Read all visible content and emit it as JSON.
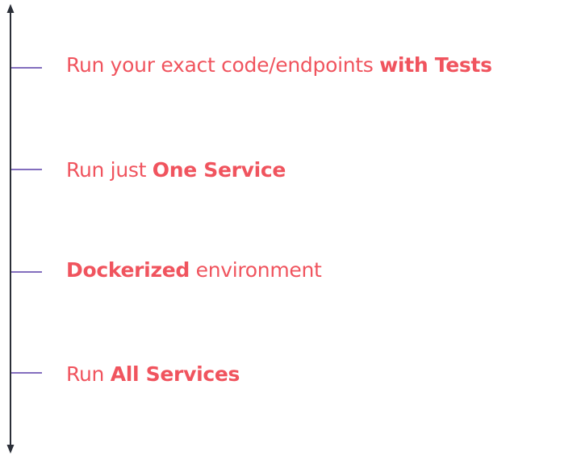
{
  "colors": {
    "text": "#f0545e",
    "axis": "#2b2f38",
    "tick": "#5a3fa8",
    "background": "#ffffff"
  },
  "items": [
    {
      "parts": [
        {
          "text": "Run your exact code/endpoints ",
          "bold": false
        },
        {
          "text": "with Tests",
          "bold": true
        }
      ]
    },
    {
      "parts": [
        {
          "text": "Run just ",
          "bold": false
        },
        {
          "text": "One Service",
          "bold": true
        }
      ]
    },
    {
      "parts": [
        {
          "text": "Dockerized",
          "bold": true
        },
        {
          "text": " environment",
          "bold": false
        }
      ]
    },
    {
      "parts": [
        {
          "text": "Run ",
          "bold": false
        },
        {
          "text": "All Services",
          "bold": true
        }
      ]
    }
  ]
}
